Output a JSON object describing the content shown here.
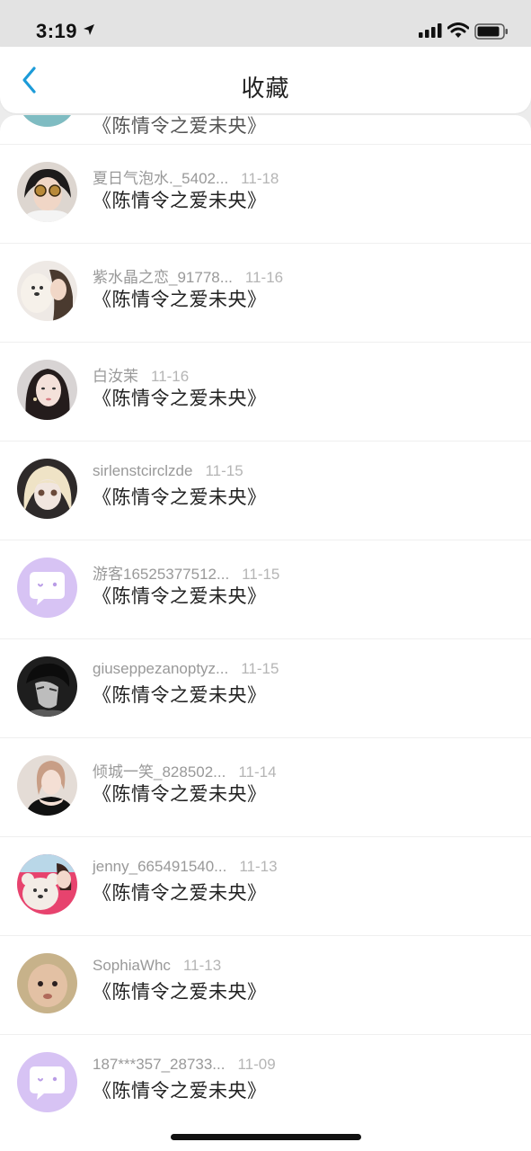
{
  "status_bar": {
    "time": "3:19",
    "icons": [
      "location-arrow-icon",
      "signal-icon",
      "wifi-icon",
      "battery-icon"
    ]
  },
  "nav": {
    "title": "收藏",
    "back_icon": "chevron-left-icon",
    "accent_color": "#1c9bd8"
  },
  "favorites": [
    {
      "username": "夏日气泡水._5402...",
      "date": "11-18",
      "title": "《陈情令之爱未央》",
      "avatar": "photo-woman-sunglasses"
    },
    {
      "username": "紫水晶之恋_91778...",
      "date": "11-16",
      "title": "《陈情令之爱未央》",
      "avatar": "photo-girl-with-dog"
    },
    {
      "username": "白汝茉",
      "date": "11-16",
      "title": "《陈情令之爱未央》",
      "avatar": "photo-woman-portrait"
    },
    {
      "username": "sirlenstcirclzde",
      "date": "11-15",
      "title": "《陈情令之爱未央》",
      "avatar": "photo-doll"
    },
    {
      "username": "游客16525377512...",
      "date": "11-15",
      "title": "《陈情令之爱未央》",
      "avatar": "default-chat-bubble"
    },
    {
      "username": "giuseppezanoptyz...",
      "date": "11-15",
      "title": "《陈情令之爱未央》",
      "avatar": "photo-man-bw"
    },
    {
      "username": "倾城一笑_828502...",
      "date": "11-14",
      "title": "《陈情令之爱未央》",
      "avatar": "photo-woman-black-dress"
    },
    {
      "username": "jenny_665491540...",
      "date": "11-13",
      "title": "《陈情令之爱未央》",
      "avatar": "photo-girl-with-teddy"
    },
    {
      "username": "SophiaWhc",
      "date": "11-13",
      "title": "《陈情令之爱未央》",
      "avatar": "photo-baby"
    },
    {
      "username": "187***357_28733...",
      "date": "11-09",
      "title": "《陈情令之爱未央》",
      "avatar": "default-chat-bubble"
    }
  ],
  "colors": {
    "default_avatar_bg": "#d7c3f4",
    "meta_text": "#999999",
    "title_text": "#222222"
  }
}
